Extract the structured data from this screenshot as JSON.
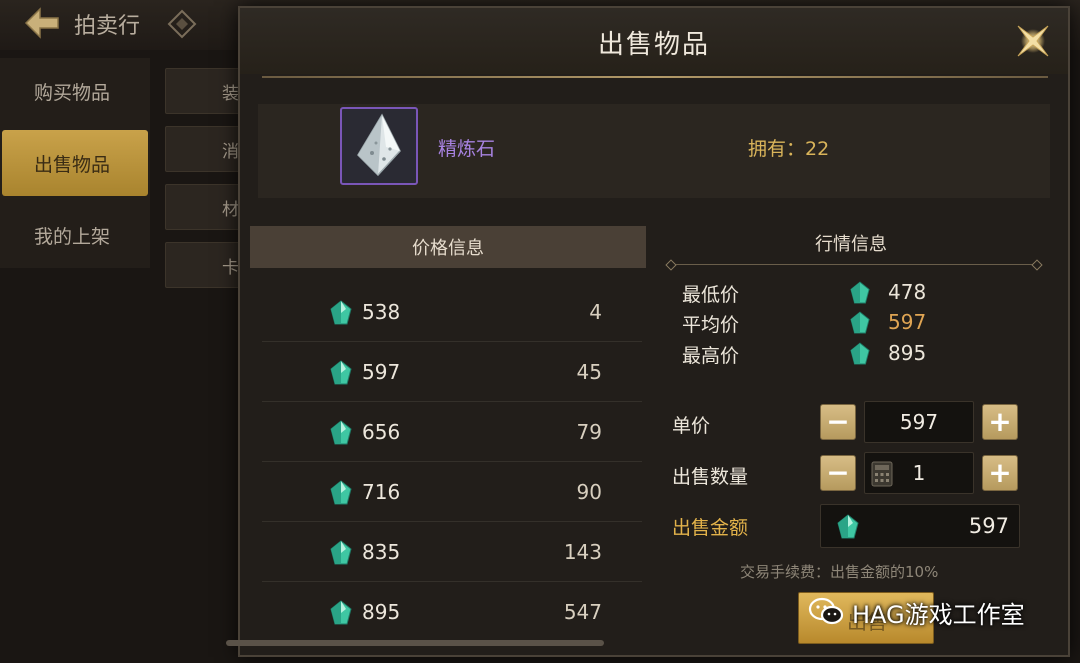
{
  "background": {
    "title": "拍卖行",
    "sidebar": [
      {
        "label": "购买物品",
        "active": false
      },
      {
        "label": "出售物品",
        "active": true
      },
      {
        "label": "我的上架",
        "active": false
      }
    ],
    "subtabs": [
      "装",
      "消",
      "材",
      "卡"
    ]
  },
  "modal": {
    "title": "出售物品",
    "item": {
      "name": "精炼石",
      "owned": "拥有：22",
      "name_color": "#a782e0"
    },
    "price_info": {
      "header": "价格信息",
      "rows": [
        {
          "price": "538",
          "qty": "4"
        },
        {
          "price": "597",
          "qty": "45"
        },
        {
          "price": "656",
          "qty": "79"
        },
        {
          "price": "716",
          "qty": "90"
        },
        {
          "price": "835",
          "qty": "143"
        },
        {
          "price": "895",
          "qty": "547"
        }
      ]
    },
    "market_info": {
      "header": "行情信息",
      "stats": [
        {
          "label": "最低价",
          "value": "478"
        },
        {
          "label": "平均价",
          "value": "597"
        },
        {
          "label": "最高价",
          "value": "895"
        }
      ]
    },
    "form": {
      "unit_price_label": "单价",
      "unit_price": "597",
      "quantity_label": "出售数量",
      "quantity": "1",
      "total_label": "出售金额",
      "total": "597",
      "fee_note": "交易手续费：出售金额的10%",
      "sell_label": "出售"
    }
  },
  "watermark": "HAG游戏工作室",
  "colors": {
    "accent_gold": "#e2b24a",
    "gem": "#3fc7a3",
    "average": "#e0a553"
  }
}
